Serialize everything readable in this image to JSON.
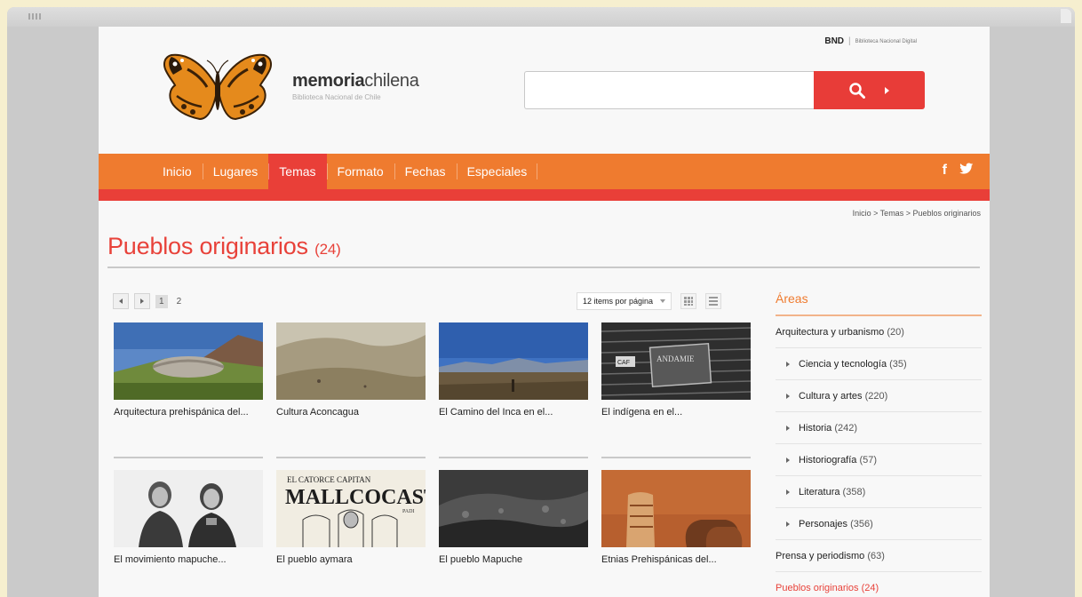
{
  "header": {
    "bnd_label": "BND",
    "bnd_sub": "Biblioteca Nacional Digital",
    "logo_main_bold": "memoria",
    "logo_main_rest": "chilena",
    "logo_sub": "Biblioteca Nacional de Chile"
  },
  "search": {
    "value": "",
    "placeholder": ""
  },
  "nav": {
    "items": [
      "Inicio",
      "Lugares",
      "Temas",
      "Formato",
      "Fechas",
      "Especiales"
    ],
    "active": "Temas",
    "social": [
      "f",
      "twitter"
    ]
  },
  "breadcrumb": "Inicio > Temas > Pueblos originarios",
  "page": {
    "title": "Pueblos originarios",
    "count": "(24)"
  },
  "pagination": {
    "pages": [
      "1",
      "2"
    ],
    "current": "1"
  },
  "view": {
    "per_page": "12 items por página"
  },
  "items": [
    {
      "caption": "Arquitectura prehispánica del..."
    },
    {
      "caption": "Cultura Aconcagua"
    },
    {
      "caption": "El Camino del Inca en el..."
    },
    {
      "caption": "El indígena en el..."
    },
    {
      "caption": "El movimiento mapuche..."
    },
    {
      "caption": "El pueblo aymara"
    },
    {
      "caption": "El pueblo Mapuche"
    },
    {
      "caption": "Etnias Prehispánicas del..."
    }
  ],
  "thumb_texts": {
    "sign": "ANDAMIE",
    "sign_small": "CAF",
    "manuscript_top": "EL CATORCE CAPITAN",
    "manuscript_main": "MALLCOCASTILLA",
    "manuscript_side": "PADI"
  },
  "sidebar": {
    "title": "Áreas",
    "items": [
      {
        "label": "Arquitectura y urbanismo",
        "count": "(20)",
        "sub": false
      },
      {
        "label": "Ciencia y tecnología",
        "count": "(35)",
        "sub": true
      },
      {
        "label": "Cultura y artes",
        "count": "(220)",
        "sub": true
      },
      {
        "label": "Historia",
        "count": "(242)",
        "sub": true
      },
      {
        "label": "Historiografía",
        "count": "(57)",
        "sub": true
      },
      {
        "label": "Literatura",
        "count": "(358)",
        "sub": true
      },
      {
        "label": "Personajes",
        "count": "(356)",
        "sub": true
      },
      {
        "label": "Prensa y periodismo",
        "count": "(63)",
        "sub": false
      },
      {
        "label": "Pueblos originarios",
        "count": "(24)",
        "sub": false,
        "active": true
      }
    ]
  },
  "colors": {
    "orange": "#ef7b2f",
    "red": "#e93f38",
    "title": "#e8423a",
    "page_bg": "#f6efcf"
  }
}
